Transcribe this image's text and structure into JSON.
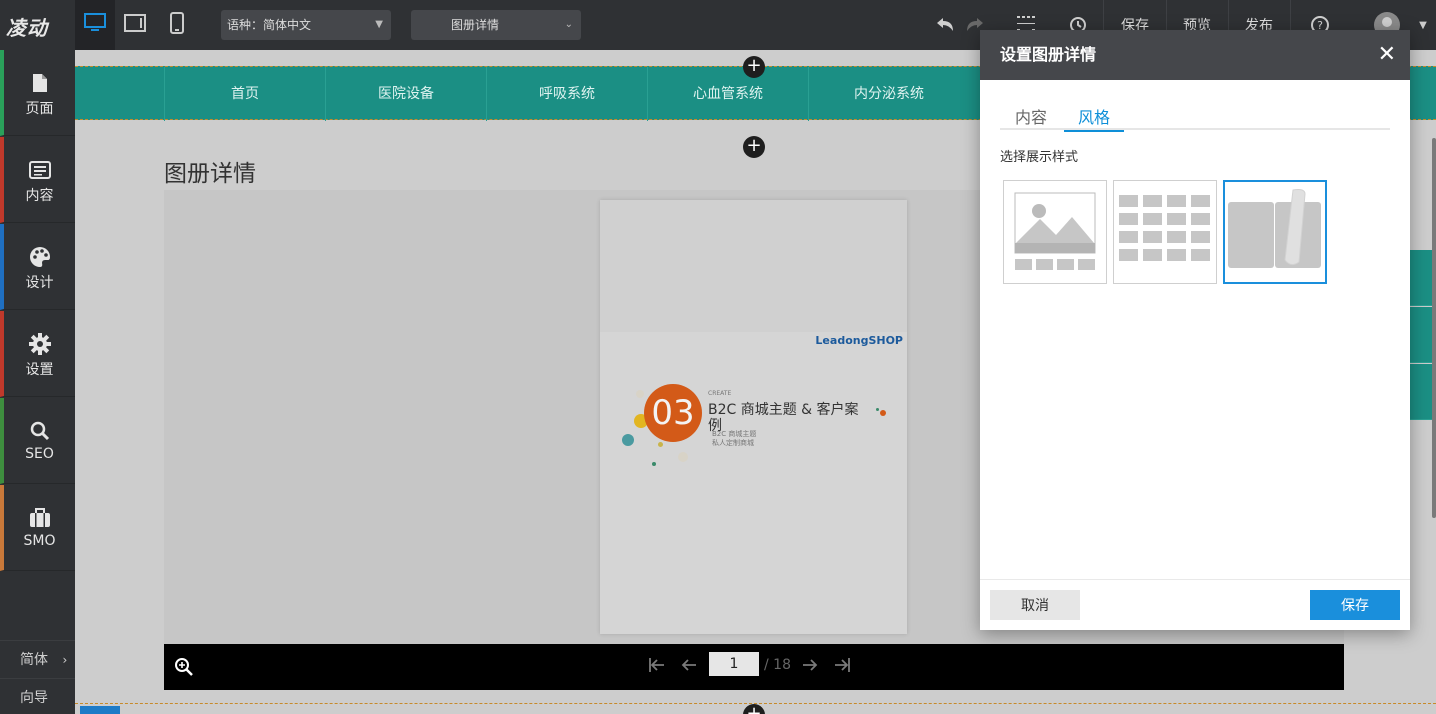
{
  "topbar": {
    "logo": "凌动",
    "language_select": "语种：简体中文",
    "page_select": "图册详情",
    "save": "保存",
    "preview": "预览",
    "publish": "发布"
  },
  "sidebar": {
    "items": [
      {
        "label": "页面",
        "icon": "page-icon",
        "color": "#2aa05a"
      },
      {
        "label": "内容",
        "icon": "list-icon",
        "color": "#c0392b"
      },
      {
        "label": "设计",
        "icon": "palette-icon",
        "color": "#1f6fc1"
      },
      {
        "label": "设置",
        "icon": "gear-icon",
        "color": "#c0392b"
      },
      {
        "label": "SEO",
        "icon": "search-icon",
        "color": "#3e8e3e"
      },
      {
        "label": "SMO",
        "icon": "briefcase-icon",
        "color": "#c9793a"
      }
    ],
    "lang": "简体",
    "guide": "向导"
  },
  "site": {
    "nav": [
      "首页",
      "医院设备",
      "呼吸系统",
      "心血管系统",
      "内分泌系统"
    ],
    "heading": "图册详情",
    "book": {
      "brand": "LeadongSHOP",
      "number": "03",
      "create": "CREATE",
      "title": "B2C 商城主题 & 客户案例",
      "sub1": "B2C 商城主题",
      "sub2": "私人定制商城"
    },
    "viewer": {
      "current_page": "1",
      "total": "/ 18"
    }
  },
  "dialog": {
    "title": "设置图册详情",
    "tabs": [
      "内容",
      "风格"
    ],
    "active_tab": "风格",
    "section_label": "选择展示样式",
    "cancel": "取消",
    "save": "保存"
  }
}
